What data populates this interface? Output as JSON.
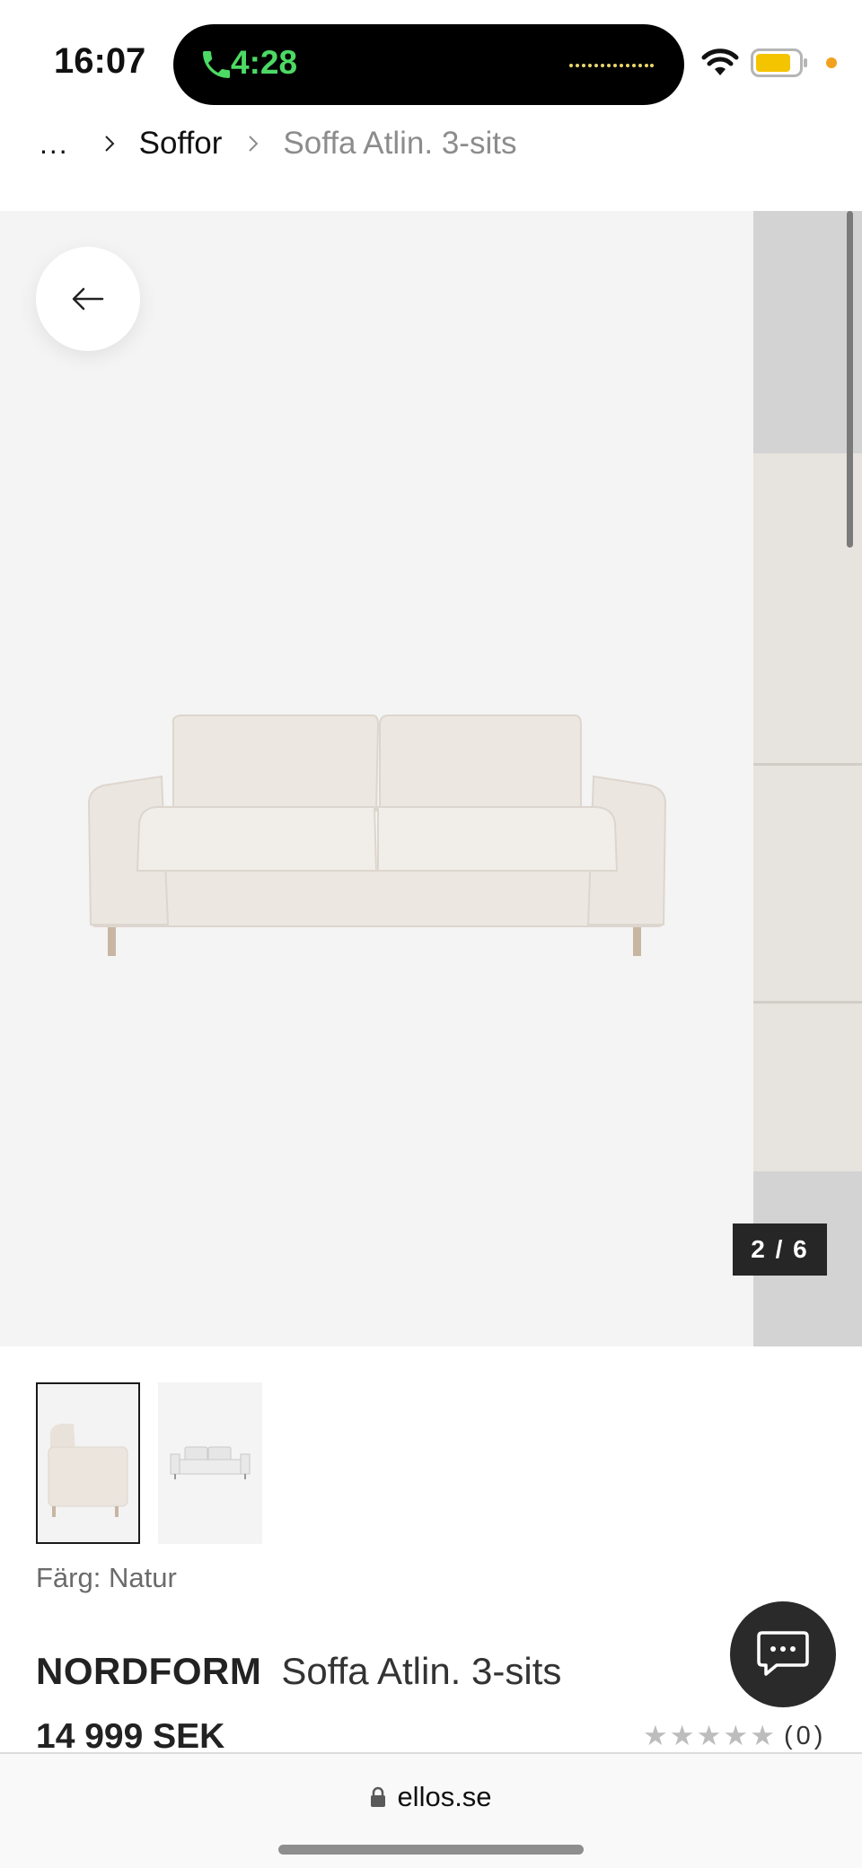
{
  "status_bar": {
    "time": "16:07",
    "call_time": "4:28"
  },
  "breadcrumb": {
    "ellipsis": "...",
    "parent": "Soffor",
    "current": "Soffa Atlin. 3-sits"
  },
  "gallery": {
    "counter": "2 / 6"
  },
  "product": {
    "color_label": "Färg: Natur",
    "brand": "NORDFORM",
    "name": "Soffa Atlin. 3-sits",
    "price": "14 999 SEK",
    "rating_stars": 0,
    "rating_count": "(0)"
  },
  "browser": {
    "url": "ellos.se"
  },
  "icons": {
    "back": "arrow-left-icon",
    "chat": "chat-bubble-icon",
    "lock": "lock-icon",
    "star": "star-icon"
  },
  "colors": {
    "call_green": "#4cd964",
    "battery_yellow": "#f5c400",
    "indicator_orange": "#f2a11f",
    "counter_bg": "#262626",
    "chat_bg": "#2a2a2a"
  }
}
